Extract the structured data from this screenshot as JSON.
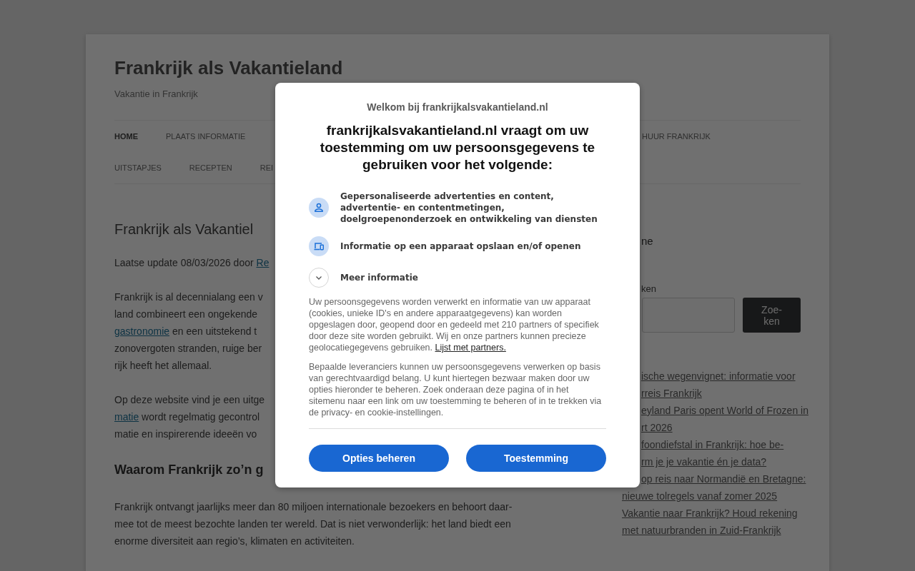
{
  "site": {
    "title": "Frankrijk als Vakantieland",
    "tagline": "Vakantie in Frankrijk"
  },
  "menu": {
    "rows": [
      {
        "items": [
          {
            "label": "HOME",
            "selected": true
          },
          {
            "label": "PLAATS INFORMATIE",
            "selected": false
          }
        ],
        "items_past_dialog": [
          {
            "label": "HUUR FRANKRIJK",
            "selected": false
          }
        ]
      },
      {
        "items": [
          {
            "label": "UITSTAPJES",
            "selected": false
          },
          {
            "label": "RECEPTEN",
            "selected": false
          },
          {
            "label": "REI",
            "selected": false
          }
        ]
      }
    ]
  },
  "article": {
    "title": "Frankrijk als Vakantiel",
    "byline": [
      {
        "kind": "text",
        "text": "Laatse update 08/03/2026 door "
      },
      {
        "kind": "link",
        "text": "Re"
      }
    ],
    "blocks": [
      {
        "kind": "paragraph",
        "lines": [
          "Frankrijk is al decennialang een v",
          "land combineert een ongekende",
          [
            {
              "kind": "link",
              "text": "gastronomie"
            },
            {
              "kind": "text",
              "text": " en een uitstekend t"
            }
          ],
          "zonovergoten stranden, ruige ber",
          "rijk heeft het allemaal."
        ]
      },
      {
        "kind": "paragraph",
        "lines": [
          "Op deze website vind je een uitge",
          [
            {
              "kind": "link",
              "text": "matie"
            },
            {
              "kind": "text",
              "text": " wordt regelmatig gecontrol"
            }
          ],
          "matie en inspirerende ideeën vo"
        ]
      },
      {
        "kind": "heading",
        "text": "Waarom Frankrijk zo’n g"
      },
      {
        "kind": "paragraph",
        "lines": [
          "Frankrijk ontvangt jaarlijks meer dan 80 miljoen internationale bezoekers en behoort daar-",
          "mee tot de meest bezochte landen ter wereld. Dat is niet verwonderlijk: het land biedt een",
          "enorme diversiteit aan regio’s, klimaten en activiteiten."
        ]
      }
    ]
  },
  "sidebar": {
    "widget_title": "ne",
    "search": {
      "label": "ken",
      "button": "Zoe-\nken"
    },
    "recent_posts": [
      {
        "lines": [
          "ische wegenvignet: informatie voor",
          "rreis Frankrijk"
        ]
      },
      {
        "lines": [
          "eyland Paris opent World of Frozen in",
          "rt 2026"
        ]
      },
      {
        "lines": [
          "foondiefstal in Frankrijk: hoe be-",
          "rm je je vakantie én je data?"
        ]
      },
      {
        "lines": [
          "op reis naar Normandië en Bretagne:",
          "nieuwe tolregels vanaf zomer 2025"
        ]
      },
      {
        "lines": [
          "Vakantie naar Frankrijk? Houd rekening",
          "met natuurbranden in Zuid-Frankrijk"
        ]
      }
    ]
  },
  "dialog": {
    "welcome": "Welkom bij frankrijkalsvakantieland.nl",
    "heading": "frankrijkalsvakantieland.nl vraagt om uw toestemming om uw persoonsgegevens te gebruiken voor het volgende:",
    "purposes": [
      {
        "kind": "purpose",
        "text": "Gepersonaliseerde advertenties en content, advertentie- en contentmetingen, doelgroepenonderzoek en ontwikkeling van diensten"
      },
      {
        "kind": "purpose",
        "text": "Informatie op een apparaat opslaan en/of openen"
      },
      {
        "kind": "expander",
        "text": "Meer informatie",
        "expanded": false
      }
    ],
    "paragraphs": [
      [
        {
          "kind": "text",
          "text": "Uw persoonsgegevens worden verwerkt en informatie van uw apparaat (cookies, unieke ID's en andere apparaatgegevens) kan worden opgeslagen door, geopend door en gedeeld met 210 partners of specifiek door deze site worden gebruikt. Wij en onze partners kunnen precieze geolocatiegegevens gebruiken. "
        },
        {
          "kind": "link",
          "text": "Lijst met partners."
        }
      ],
      [
        {
          "kind": "text",
          "text": "Bepaalde leveranciers kunnen uw persoonsgegevens verwerken op basis van gerechtvaardigd belang. U kunt hiertegen bezwaar maken door uw opties hieronder te beheren. Zoek onderaan deze pagina of in het sitemenu naar een link om uw toestemming te beheren of in te trekken via de privacy- en cookie-instellingen."
        }
      ]
    ],
    "buttons": [
      "Opties beheren",
      "Toestemming"
    ]
  }
}
